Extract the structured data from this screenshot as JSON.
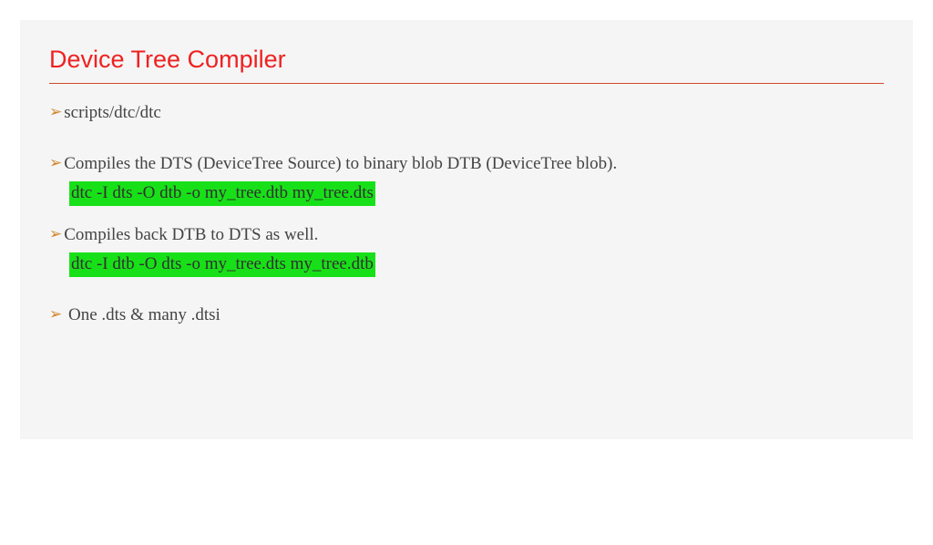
{
  "title": "Device Tree Compiler",
  "bullets": [
    {
      "text": "scripts/dtc/dtc",
      "cmd": null
    },
    {
      "text": "Compiles the DTS (DeviceTree Source) to binary blob DTB (DeviceTree blob).",
      "cmd": "dtc -I dts -O dtb -o my_tree.dtb my_tree.dts"
    },
    {
      "text": "Compiles back DTB to DTS as well.",
      "cmd": "dtc -I dtb -O dts -o my_tree.dts my_tree.dtb"
    },
    {
      "text": " One .dts & many .dtsi",
      "cmd": null
    }
  ],
  "bullet_glyph": "➢"
}
